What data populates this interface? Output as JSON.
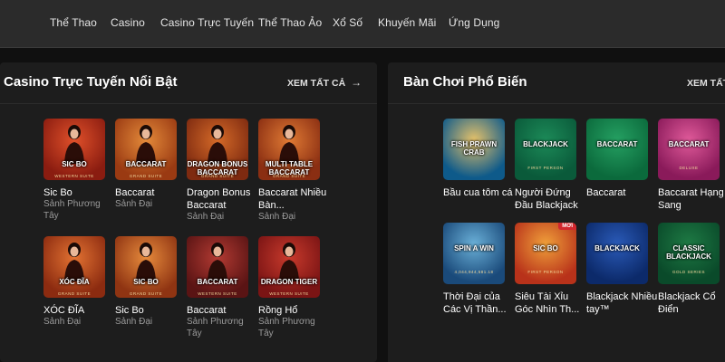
{
  "nav": {
    "items": [
      {
        "label": "Thể Thao"
      },
      {
        "label": "Casino"
      },
      {
        "label": "Casino Trực Tuyến"
      },
      {
        "label": "Thể Thao Ảo"
      },
      {
        "label": "Xổ Số"
      },
      {
        "label": "Khuyến Mãi"
      },
      {
        "label": "Ứng Dụng"
      }
    ]
  },
  "featured": {
    "title": "Casino Trực Tuyến Nổi Bật",
    "see_all": "XEM TẤT CẢ",
    "games": [
      {
        "name": "Sic Bo",
        "provider": "Sảnh Phương Tây",
        "logo": "SIC BO",
        "logo_sub": "WESTERN SUITE",
        "bg": "#8a1c10",
        "bg2": "#e0502a"
      },
      {
        "name": "Baccarat",
        "provider": "Sảnh Đại",
        "logo": "BACCARAT",
        "logo_sub": "GRAND SUITE",
        "bg": "#9a3a12",
        "bg2": "#e48a3a"
      },
      {
        "name": "Dragon Bonus Baccarat",
        "provider": "Sảnh Đại",
        "logo": "DRAGON BONUS BACCARAT",
        "logo_sub": "GRAND SUITE",
        "bg": "#7e2a10",
        "bg2": "#d56a28"
      },
      {
        "name": "Baccarat Nhiều Bàn...",
        "provider": "Sảnh Đại",
        "logo": "MULTI TABLE BACCARAT",
        "logo_sub": "GRAND SUITE",
        "bg": "#8a2e12",
        "bg2": "#e07a34"
      },
      {
        "name": "XÓC ĐĨA",
        "provider": "Sảnh Đại",
        "logo": "XÓC ĐĨA",
        "logo_sub": "GRAND SUITE",
        "bg": "#8c2b10",
        "bg2": "#e27232"
      },
      {
        "name": "Sic Bo",
        "provider": "Sảnh Đại",
        "logo": "SIC BO",
        "logo_sub": "GRAND SUITE",
        "bg": "#8f3412",
        "bg2": "#e68a3c"
      },
      {
        "name": "Baccarat",
        "provider": "Sảnh Phương Tây",
        "logo": "BACCARAT",
        "logo_sub": "WESTERN SUITE",
        "bg": "#5a1414",
        "bg2": "#b23a32"
      },
      {
        "name": "Rồng Hổ",
        "provider": "Sảnh Phương Tây",
        "logo": "DRAGON TIGER",
        "logo_sub": "WESTERN SUITE",
        "bg": "#7a1414",
        "bg2": "#c83a2c"
      }
    ]
  },
  "popular": {
    "title": "Bàn Chơi Phổ Biến",
    "see_all": "XEM TẤT CẢ",
    "games": [
      {
        "name": "Bầu cua tôm cá",
        "provider": "",
        "logo": "FISH PRAWN CRAB",
        "logo_sub": "",
        "bg": "#0e5a8a",
        "bg2": "#e6c26a",
        "badge": ""
      },
      {
        "name": "Người Đứng Đầu Blackjack",
        "provider": "",
        "logo": "BLACKJACK",
        "logo_sub": "FIRST PERSON",
        "bg": "#0a5a3a",
        "bg2": "#1c8a58",
        "badge": ""
      },
      {
        "name": "Baccarat",
        "provider": "",
        "logo": "BACCARAT",
        "logo_sub": "",
        "bg": "#0b6a3c",
        "bg2": "#25a062",
        "badge": ""
      },
      {
        "name": "Baccarat Hạng Sang",
        "provider": "",
        "logo": "BACCARAT",
        "logo_sub": "DELUXE",
        "bg": "#8a1a5a",
        "bg2": "#e05a9a",
        "badge": ""
      },
      {
        "name": "Thời Đại của Các Vị Thần...",
        "provider": "",
        "logo": "SPIN A WIN",
        "logo_sub": "4,044,944,581.18",
        "bg": "#1a4a7a",
        "bg2": "#6ab0d8",
        "badge": ""
      },
      {
        "name": "Siêu Tài Xỉu Góc Nhìn Th...",
        "provider": "",
        "logo": "SIC BO",
        "logo_sub": "FIRST PERSON",
        "bg": "#b8321a",
        "bg2": "#f0a03a",
        "badge": "MỚI"
      },
      {
        "name": "Blackjack Nhiều tay™",
        "provider": "",
        "logo": "BLACKJACK",
        "logo_sub": "",
        "bg": "#0c2a6a",
        "bg2": "#2a5ab8",
        "badge": ""
      },
      {
        "name": "Blackjack Cổ Điển",
        "provider": "",
        "logo": "CLASSIC BLACKJACK",
        "logo_sub": "GOLD SERIES",
        "bg": "#0a4a2a",
        "bg2": "#1e7a44",
        "badge": ""
      }
    ]
  }
}
